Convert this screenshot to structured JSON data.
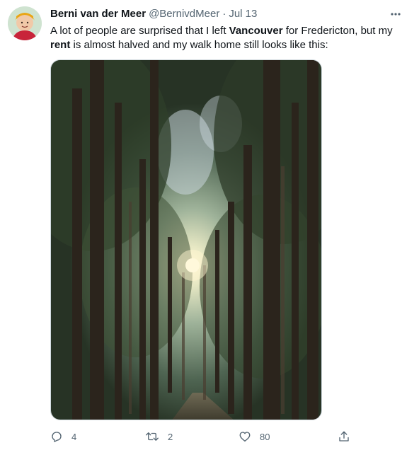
{
  "tweet": {
    "author_name": "Berni van der Meer",
    "author_handle": "@BernivdMeer",
    "separator": "·",
    "time": "Jul 13",
    "text_parts": {
      "p1": "A lot of people are surprised that I left ",
      "b1": "Vancouver",
      "p2": " for Fredericton, but my ",
      "b2": "rent",
      "p3": " is almost halved and my walk home still looks like this:"
    },
    "icons": {
      "more": "more-horizontal-icon",
      "reply": "reply-icon",
      "retweet": "retweet-icon",
      "like": "heart-icon",
      "share": "share-icon"
    },
    "metrics": {
      "replies": "4",
      "retweets": "2",
      "likes": "80"
    }
  }
}
